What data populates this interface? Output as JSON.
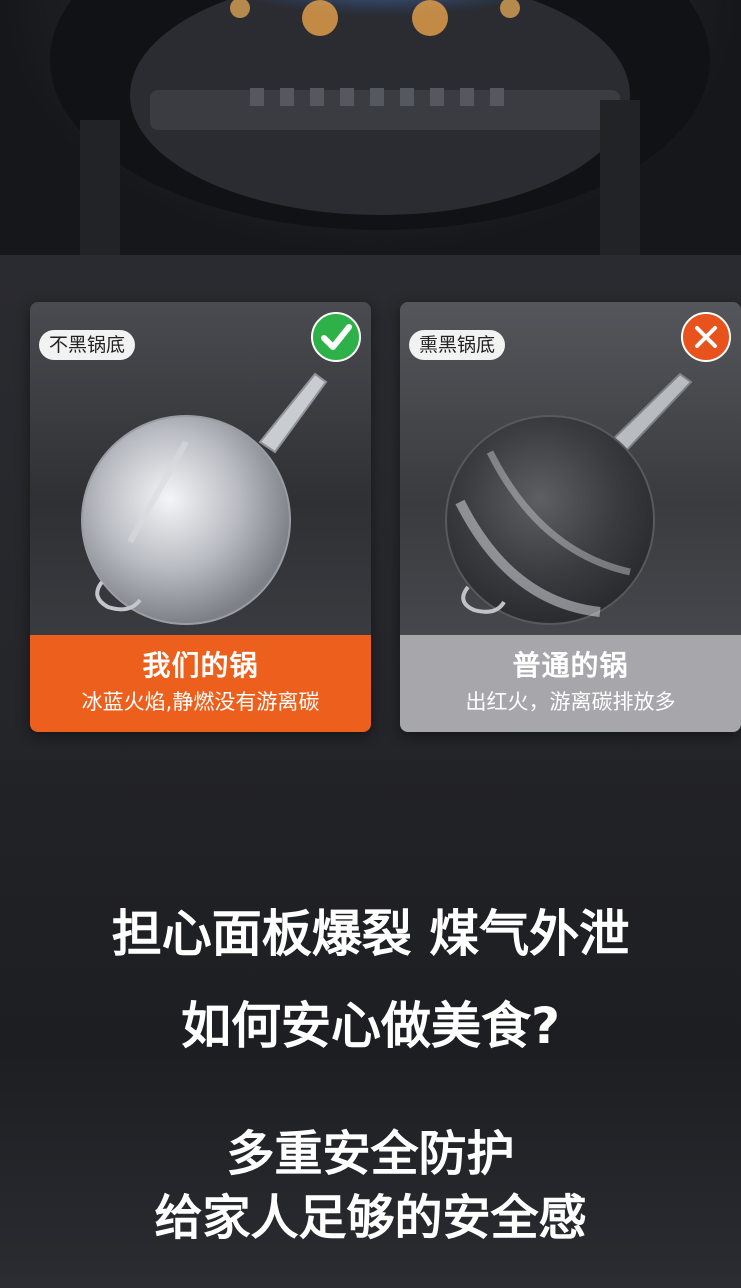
{
  "comparison": {
    "ours": {
      "tag": "不黑锅底",
      "verdict": "check",
      "verdict_color": "#2fb14a",
      "title": "我们的锅",
      "subtitle": "冰蓝火焰,静燃没有游离碳",
      "band_color": "#ec5f1c"
    },
    "ordinary": {
      "tag": "熏黑锅底",
      "verdict": "X",
      "verdict_color": "#e8521c",
      "title": "普通的锅",
      "subtitle": "出红火，游离碳排放多",
      "band_color": "#a6a6ab"
    }
  },
  "headline": {
    "line1": "担心面板爆裂 煤气外泄",
    "line2": "如何安心做美食?"
  },
  "slogan": {
    "line1": "多重安全防护",
    "line2": "给家人足够的安全感"
  }
}
